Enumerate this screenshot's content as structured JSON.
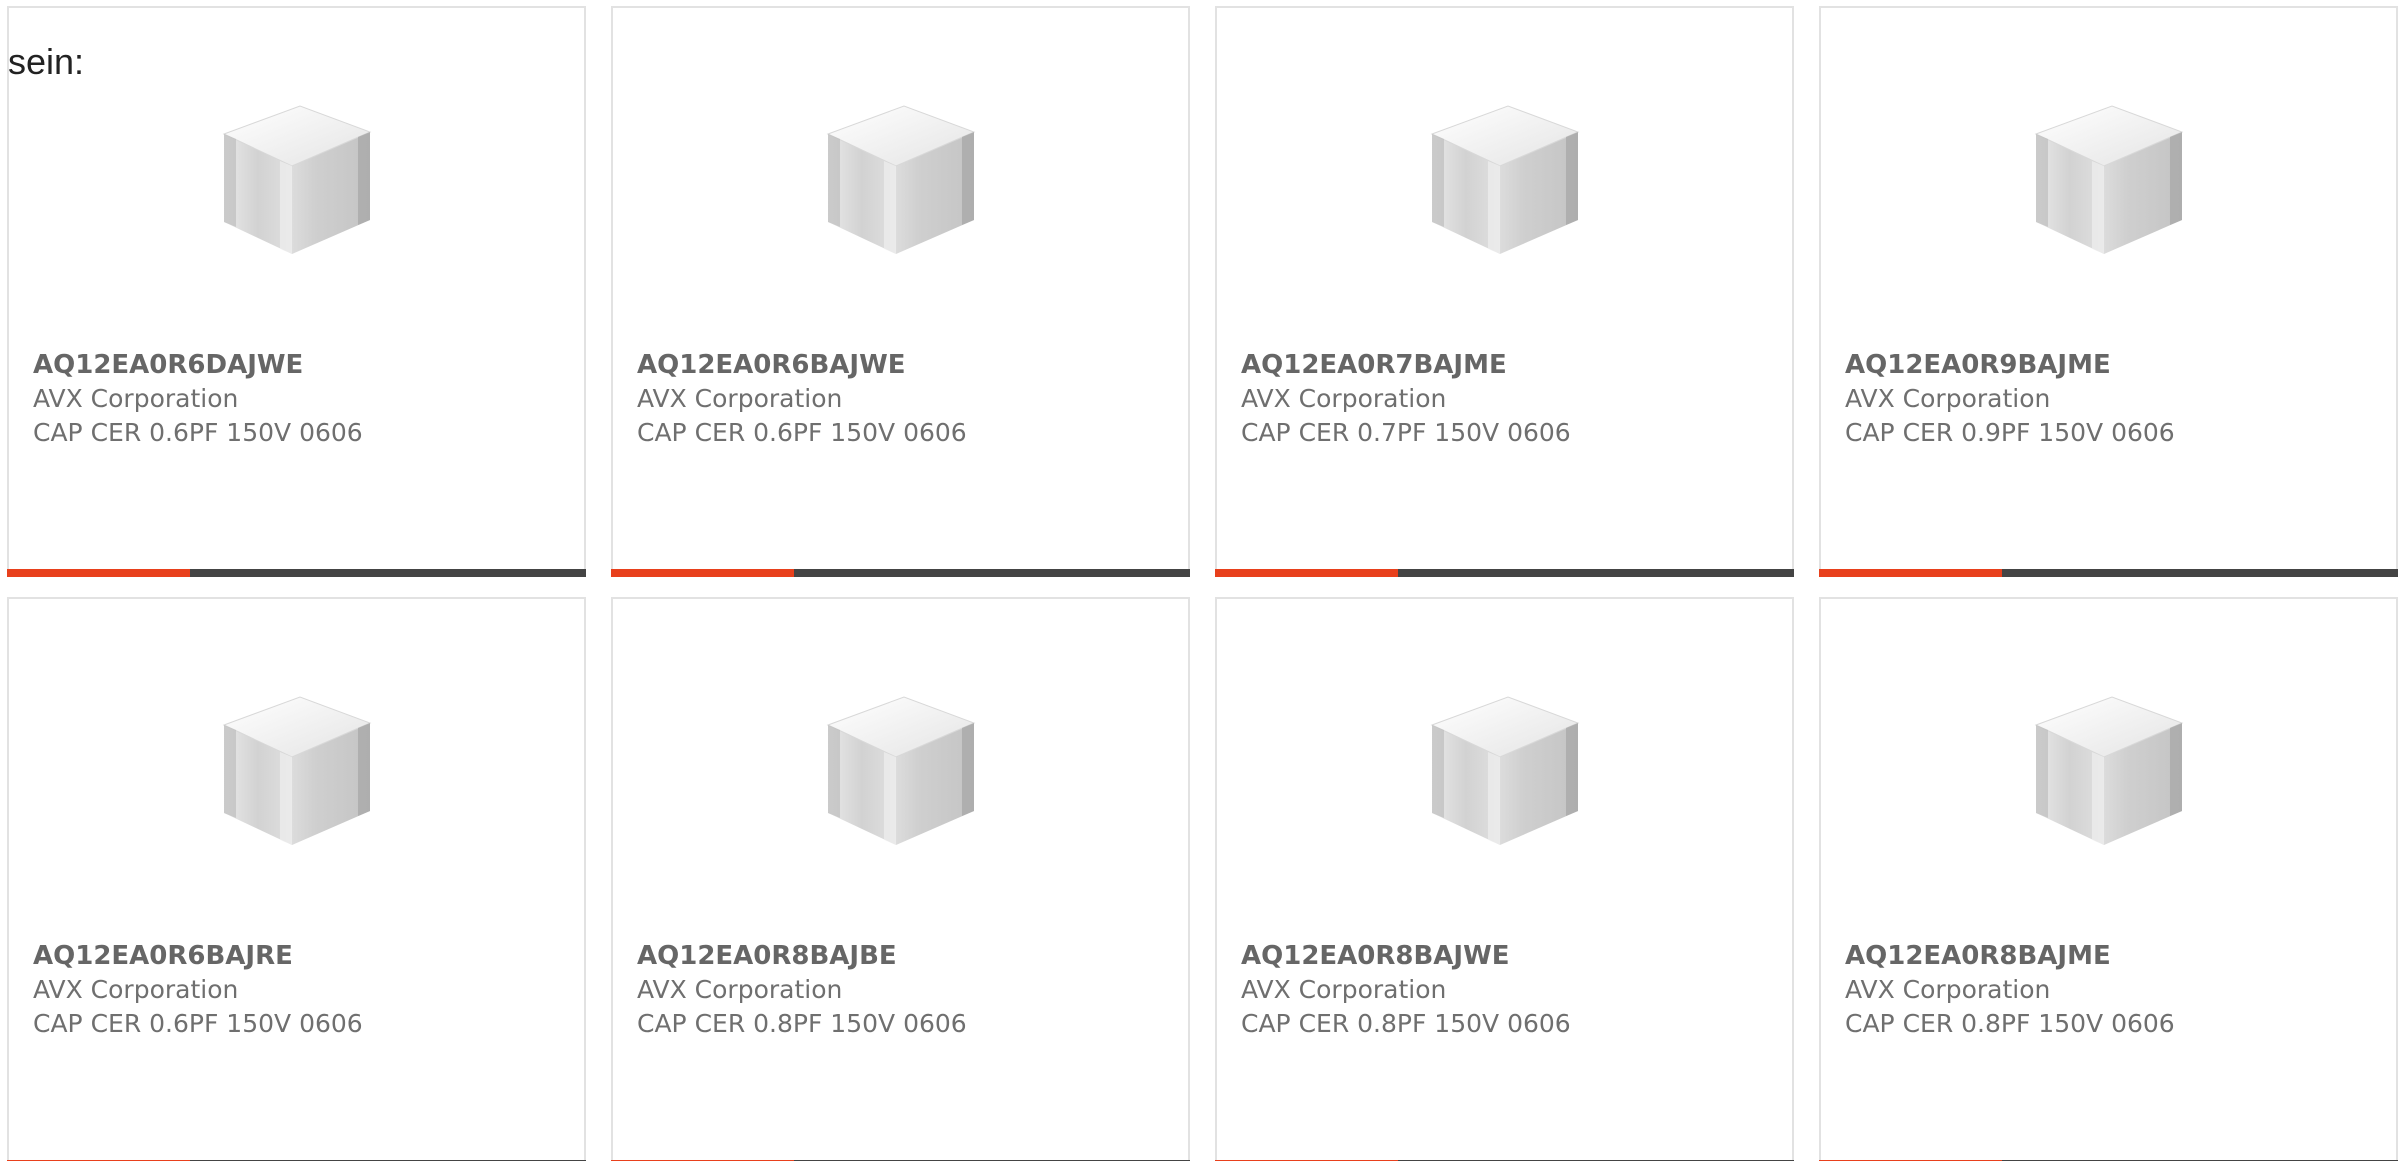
{
  "intro_text": "sein:",
  "colors": {
    "accent": "#e8401c",
    "bar": "#444444",
    "border": "#e2e2e2",
    "text": "#666666"
  },
  "image_icon": "ceramic-capacitor-cube-icon",
  "products": [
    {
      "part_number": "AQ12EA0R6DAJWE",
      "manufacturer": "AVX Corporation",
      "description": "CAP CER 0.6PF 150V 0606"
    },
    {
      "part_number": "AQ12EA0R6BAJWE",
      "manufacturer": "AVX Corporation",
      "description": "CAP CER 0.6PF 150V 0606"
    },
    {
      "part_number": "AQ12EA0R7BAJME",
      "manufacturer": "AVX Corporation",
      "description": "CAP CER 0.7PF 150V 0606"
    },
    {
      "part_number": "AQ12EA0R9BAJME",
      "manufacturer": "AVX Corporation",
      "description": "CAP CER 0.9PF 150V 0606"
    },
    {
      "part_number": "AQ12EA0R6BAJRE",
      "manufacturer": "AVX Corporation",
      "description": "CAP CER 0.6PF 150V 0606"
    },
    {
      "part_number": "AQ12EA0R8BAJBE",
      "manufacturer": "AVX Corporation",
      "description": "CAP CER 0.8PF 150V 0606"
    },
    {
      "part_number": "AQ12EA0R8BAJWE",
      "manufacturer": "AVX Corporation",
      "description": "CAP CER 0.8PF 150V 0606"
    },
    {
      "part_number": "AQ12EA0R8BAJME",
      "manufacturer": "AVX Corporation",
      "description": "CAP CER 0.8PF 150V 0606"
    }
  ]
}
